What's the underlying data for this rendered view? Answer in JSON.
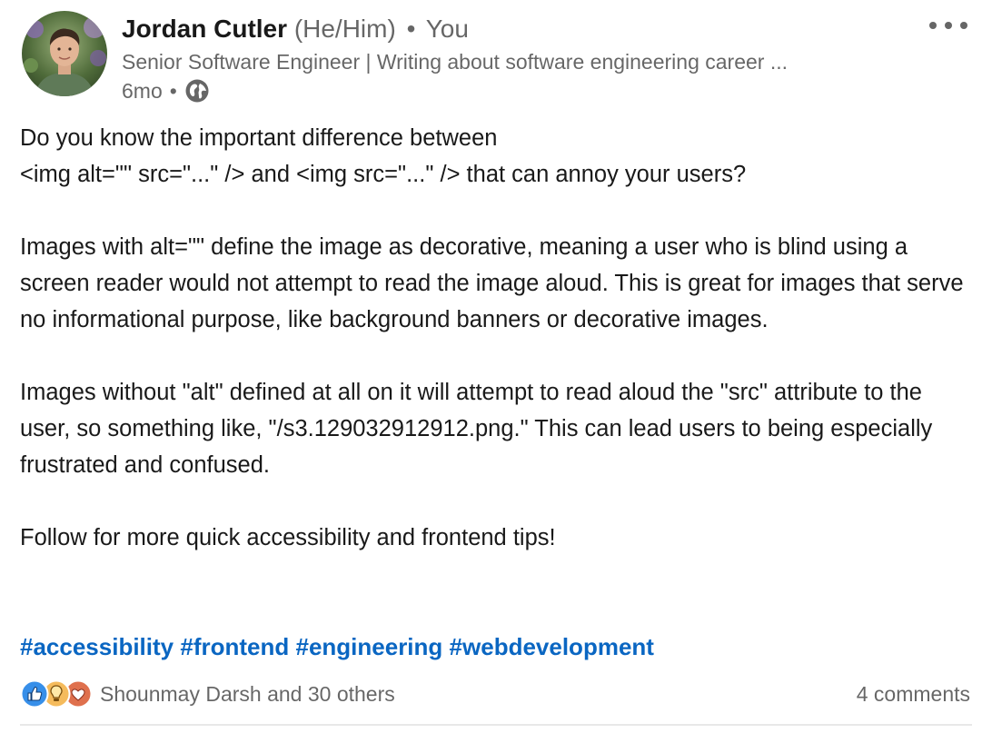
{
  "author": {
    "name": "Jordan Cutler",
    "pronouns": "(He/Him)",
    "separator": "•",
    "relation": "You",
    "headline": "Senior Software Engineer | Writing about software engineering career ...",
    "time": "6mo",
    "time_separator": "•",
    "visibility_icon": "globe-icon"
  },
  "post": {
    "paragraphs": [
      [
        "Do you know the important difference between",
        "<img alt=\"\" src=\"...\" /> and <img src=\"...\" /> that can annoy your users?"
      ],
      [
        "Images with alt=\"\" define the image as decorative, meaning a user who is blind using a screen reader would not attempt to read the image aloud. This is great for images that serve no informational purpose, like background banners or decorative images."
      ],
      [
        "Images without \"alt\" defined at all on it will attempt to read aloud the \"src\" attribute to the user, so something like, \"/s3.129032912912.png.\" This can lead users to being especially frustrated and confused."
      ],
      [
        "Follow for more quick accessibility and frontend tips!"
      ]
    ],
    "hashtags": [
      "#accessibility",
      "#frontend",
      "#engineering",
      "#webdevelopment"
    ]
  },
  "social": {
    "reaction_icons": [
      "like-icon",
      "insightful-icon",
      "love-icon"
    ],
    "reactions_text": "Shounmay Darsh and 30 others",
    "comments_text": "4 comments"
  },
  "colors": {
    "link_blue": "#0a66c2",
    "secondary_text": "#666666",
    "like_blue": "#378fe9",
    "insightful_yellow": "#f5bb5c",
    "love_red": "#df704d"
  }
}
